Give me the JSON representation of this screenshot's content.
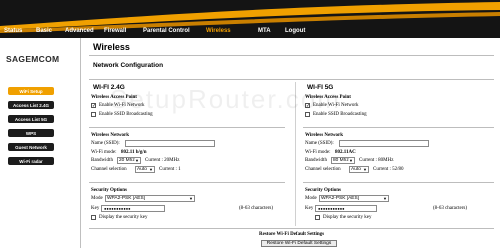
{
  "nav": {
    "items": [
      "Status",
      "Basic",
      "Advanced",
      "Firewall",
      "Parental Control",
      "Wireless",
      "MTA",
      "Logout"
    ],
    "active": "Wireless"
  },
  "brand": {
    "logo": "SAGEMCOM"
  },
  "sidebar": {
    "items": [
      "WiFi Setup",
      "Access List 2.4G",
      "Access List 5G",
      "WPS",
      "Guest Network",
      "Wi-Fi radar"
    ],
    "active": "WiFi Setup"
  },
  "page": {
    "title": "Wireless",
    "subtitle": "Network Configuration"
  },
  "watermark": "SetupRouter.com",
  "colors": {
    "accent": "#f0a000",
    "banner": "#141414"
  },
  "wifi24": {
    "band_title": "WI-FI 2.4G",
    "access_point_title": "Wireless Access Point",
    "enable_wifi_label": "Enable Wi-Fi Network",
    "enable_wifi_checked": true,
    "enable_ssid_label": "Enable SSID Broadcasting",
    "enable_ssid_checked": false,
    "network_title": "Wireless Network",
    "ssid_label": "Name (SSID):",
    "ssid_value": "",
    "mode_label": "Wi-Fi mode:",
    "mode_value": "802.11 b/g/n",
    "bandwidth_label": "Bandwidth",
    "bandwidth_value": "20 Mhz",
    "bandwidth_current": "Current : 20MHz",
    "channel_label": "Channel selection",
    "channel_value": "Auto",
    "channel_current": "Current : 1",
    "security_title": "Security Options",
    "mode_sec_label": "Mode",
    "security_mode": "WPA2-PSK [AES]",
    "key_label": "Key",
    "key_value": "●●●●●●●●●●●",
    "key_hint": "(8-63 characters)",
    "display_key_label": "Display the security key"
  },
  "wifi5": {
    "band_title": "WI-FI 5G",
    "access_point_title": "Wireless Access Point",
    "enable_wifi_label": "Enable Wi-Fi Network",
    "enable_wifi_checked": true,
    "enable_ssid_label": "Enable SSID Broadcasting",
    "enable_ssid_checked": false,
    "network_title": "Wireless Network",
    "ssid_label": "Name (SSID):",
    "ssid_value": "",
    "mode_label": "Wi-Fi mode:",
    "mode_value": "802.11AC",
    "bandwidth_label": "Bandwidth",
    "bandwidth_value": "80 Mhz",
    "bandwidth_current": "Current : 80MHz",
    "channel_label": "Channel selection",
    "channel_value": "Auto",
    "channel_current": "Current : 52/80",
    "security_title": "Security Options",
    "mode_sec_label": "Mode",
    "security_mode": "WPA2-PSK [AES]",
    "key_label": "Key",
    "key_value": "●●●●●●●●●●●",
    "key_hint": "(8-63 characters)",
    "display_key_label": "Display the security key"
  },
  "footer": {
    "restore_label": "Restore Wi-Fi Default Settings",
    "restore_button": "Restore Wi-Fi Default Settings"
  }
}
